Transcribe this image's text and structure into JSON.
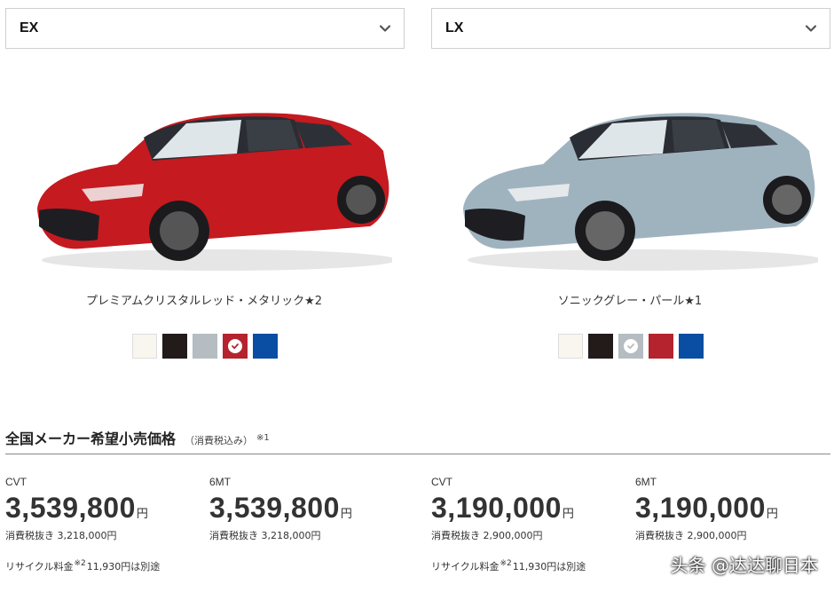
{
  "trims": [
    {
      "name": "EX",
      "color_name": "プレミアムクリスタルレッド・メタリック★2",
      "swatches": [
        {
          "name": "white",
          "color": "#f8f6ef",
          "selected": false
        },
        {
          "name": "black",
          "color": "#231a1a",
          "selected": false
        },
        {
          "name": "gray",
          "color": "#b5bcc2",
          "selected": false
        },
        {
          "name": "red",
          "color": "#b5232e",
          "selected": true
        },
        {
          "name": "blue",
          "color": "#0a4ea3",
          "selected": false
        }
      ],
      "prices": [
        {
          "transmission": "CVT",
          "price": "3,539,800",
          "yen": "円",
          "excl_tax": "消費税抜き 3,218,000円"
        },
        {
          "transmission": "6MT",
          "price": "3,539,800",
          "yen": "円",
          "excl_tax": "消費税抜き 3,218,000円"
        }
      ],
      "recycle": {
        "label": "リサイクル料金",
        "note": "※2",
        "amount": "11,930円は別途"
      }
    },
    {
      "name": "LX",
      "color_name": "ソニックグレー・パール★1",
      "swatches": [
        {
          "name": "white",
          "color": "#f8f6ef",
          "selected": false
        },
        {
          "name": "black",
          "color": "#231a1a",
          "selected": false
        },
        {
          "name": "gray",
          "color": "#b5bcc2",
          "selected": true
        },
        {
          "name": "red",
          "color": "#b5232e",
          "selected": false
        },
        {
          "name": "blue",
          "color": "#0a4ea3",
          "selected": false
        }
      ],
      "prices": [
        {
          "transmission": "CVT",
          "price": "3,190,000",
          "yen": "円",
          "excl_tax": "消費税抜き 2,900,000円"
        },
        {
          "transmission": "6MT",
          "price": "3,190,000",
          "yen": "円",
          "excl_tax": "消費税抜き 2,900,000円"
        }
      ],
      "recycle": {
        "label": "リサイクル料金",
        "note": "※2",
        "amount": "11,930円は別途"
      }
    }
  ],
  "price_section": {
    "title": "全国メーカー希望小売価格",
    "tax_note": "（消費税込み）",
    "note_mark": "※1"
  },
  "watermark": "头条 @达达聊日本",
  "icons": {
    "dropdown": "chevron-down-icon",
    "selected": "checkmark-icon"
  }
}
